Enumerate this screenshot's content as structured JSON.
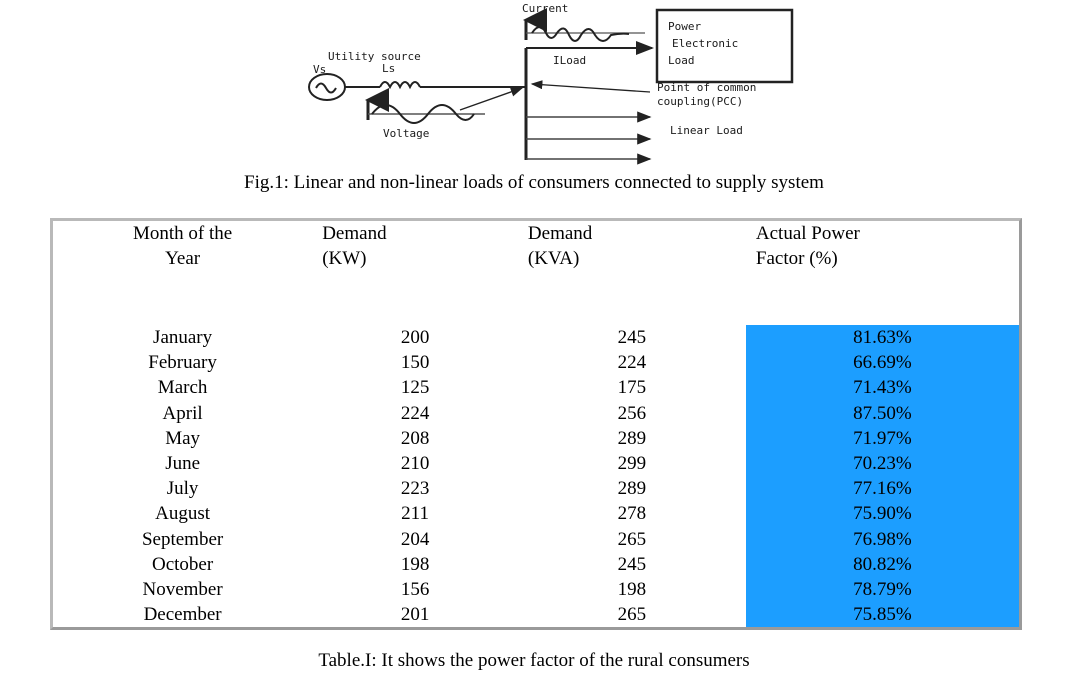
{
  "figure": {
    "caption": "Fig.1: Linear and non-linear loads of consumers connected to supply system",
    "labels": {
      "current": "Current",
      "vs": "Vs",
      "utility_source": "Utility source",
      "ls": "Ls",
      "voltage": "Voltage",
      "iload": "ILoad",
      "power_electronic_load_1": "Power",
      "power_electronic_load_2": "Electronic",
      "power_electronic_load_3": "Load",
      "pcc_1": "Point of common",
      "pcc_2": "coupling(PCC)",
      "linear_load": "Linear Load"
    }
  },
  "table": {
    "caption": "Table.I: It shows the power factor of the rural consumers",
    "highlight_color": "#1c9eff",
    "border_color": "#9a9a9a",
    "headers": [
      {
        "line1": "Month of the",
        "line2": "Year"
      },
      {
        "line1": "Demand",
        "line2": "(KW)"
      },
      {
        "line1": "Demand",
        "line2": "(KVA)"
      },
      {
        "line1": "Actual Power",
        "line2": "Factor (%)"
      }
    ],
    "rows": [
      {
        "month": "January",
        "demand_kw": "200",
        "demand_kva": "245",
        "power_factor": "81.63%"
      },
      {
        "month": "February",
        "demand_kw": "150",
        "demand_kva": "224",
        "power_factor": "66.69%"
      },
      {
        "month": "March",
        "demand_kw": "125",
        "demand_kva": "175",
        "power_factor": "71.43%"
      },
      {
        "month": "April",
        "demand_kw": "224",
        "demand_kva": "256",
        "power_factor": "87.50%"
      },
      {
        "month": "May",
        "demand_kw": "208",
        "demand_kva": "289",
        "power_factor": "71.97%"
      },
      {
        "month": "June",
        "demand_kw": "210",
        "demand_kva": "299",
        "power_factor": "70.23%"
      },
      {
        "month": "July",
        "demand_kw": "223",
        "demand_kva": "289",
        "power_factor": "77.16%"
      },
      {
        "month": "August",
        "demand_kw": "211",
        "demand_kva": "278",
        "power_factor": "75.90%"
      },
      {
        "month": "September",
        "demand_kw": "204",
        "demand_kva": "265",
        "power_factor": "76.98%"
      },
      {
        "month": "October",
        "demand_kw": "198",
        "demand_kva": "245",
        "power_factor": "80.82%"
      },
      {
        "month": "November",
        "demand_kw": "156",
        "demand_kva": "198",
        "power_factor": "78.79%"
      },
      {
        "month": "December",
        "demand_kw": "201",
        "demand_kva": "265",
        "power_factor": "75.85%"
      }
    ]
  },
  "chart_data": {
    "type": "table",
    "title": "Table.I: It shows the power factor of the rural consumers",
    "columns": [
      "Month of the Year",
      "Demand (KW)",
      "Demand (KVA)",
      "Actual Power Factor (%)"
    ],
    "categories": [
      "January",
      "February",
      "March",
      "April",
      "May",
      "June",
      "July",
      "August",
      "September",
      "October",
      "November",
      "December"
    ],
    "series": [
      {
        "name": "Demand (KW)",
        "values": [
          200,
          150,
          125,
          224,
          208,
          210,
          223,
          211,
          204,
          198,
          156,
          201
        ]
      },
      {
        "name": "Demand (KVA)",
        "values": [
          245,
          224,
          175,
          256,
          289,
          299,
          289,
          278,
          265,
          245,
          198,
          265
        ]
      },
      {
        "name": "Actual Power Factor (%)",
        "values": [
          81.63,
          66.69,
          71.43,
          87.5,
          71.97,
          70.23,
          77.16,
          75.9,
          76.98,
          80.82,
          78.79,
          75.85
        ]
      }
    ]
  }
}
